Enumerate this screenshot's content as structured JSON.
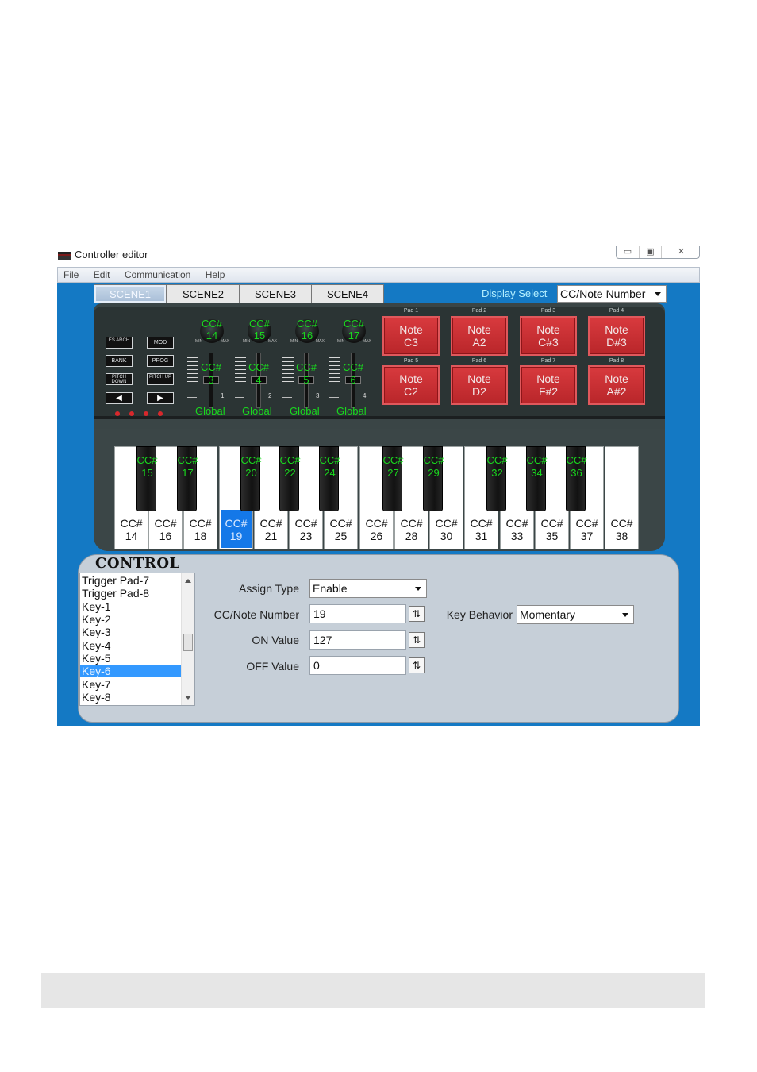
{
  "window": {
    "title": "Controller editor",
    "controls": {
      "minimize": "▭",
      "maximize": "▣",
      "close": "✕"
    }
  },
  "menu": [
    "File",
    "Edit",
    "Communication",
    "Help"
  ],
  "scenes": {
    "tabs": [
      "SCENE1",
      "SCENE2",
      "SCENE3",
      "SCENE4"
    ],
    "active": "SCENE1"
  },
  "display_select": {
    "label": "Display Select",
    "value": "CC/Note Number"
  },
  "panel_buttons": [
    {
      "name": "es-button",
      "label": "ES ARCH"
    },
    {
      "name": "mod-button",
      "label": "MOD"
    },
    {
      "name": "bank-button",
      "label": "BANK"
    },
    {
      "name": "prog-button",
      "label": "PROG"
    },
    {
      "name": "pitch-down-button",
      "label": "PITCH DOWN"
    },
    {
      "name": "pitch-up-button",
      "label": "PITCH UP"
    }
  ],
  "arrows": {
    "left": "◀",
    "right": "▶"
  },
  "knobs": [
    {
      "l1": "CC#",
      "l2": "14",
      "min": "MIN",
      "max": "MAX"
    },
    {
      "l1": "CC#",
      "l2": "15",
      "min": "MIN",
      "max": "MAX"
    },
    {
      "l1": "CC#",
      "l2": "16",
      "min": "MIN",
      "max": "MAX"
    },
    {
      "l1": "CC#",
      "l2": "17",
      "min": "MIN",
      "max": "MAX"
    }
  ],
  "sliders": [
    {
      "l1": "CC#",
      "l2": "3",
      "num": "1",
      "global": "Global"
    },
    {
      "l1": "CC#",
      "l2": "4",
      "num": "2",
      "global": "Global"
    },
    {
      "l1": "CC#",
      "l2": "5",
      "num": "3",
      "global": "Global"
    },
    {
      "l1": "CC#",
      "l2": "6",
      "num": "4",
      "global": "Global"
    }
  ],
  "pads": [
    {
      "label": "Pad 1",
      "l1": "Note",
      "l2": "C3"
    },
    {
      "label": "Pad 2",
      "l1": "Note",
      "l2": "A2"
    },
    {
      "label": "Pad 3",
      "l1": "Note",
      "l2": "C#3"
    },
    {
      "label": "Pad 4",
      "l1": "Note",
      "l2": "D#3"
    },
    {
      "label": "Pad 5",
      "l1": "Note",
      "l2": "C2"
    },
    {
      "label": "Pad 6",
      "l1": "Note",
      "l2": "D2"
    },
    {
      "label": "Pad 7",
      "l1": "Note",
      "l2": "F#2"
    },
    {
      "label": "Pad 8",
      "l1": "Note",
      "l2": "A#2"
    }
  ],
  "white_keys": [
    {
      "c1": "CC#",
      "c2": "14"
    },
    {
      "c1": "CC#",
      "c2": "16"
    },
    {
      "c1": "CC#",
      "c2": "18"
    },
    {
      "c1": "CC#",
      "c2": "19",
      "selected": true
    },
    {
      "c1": "CC#",
      "c2": "21"
    },
    {
      "c1": "CC#",
      "c2": "23"
    },
    {
      "c1": "CC#",
      "c2": "25"
    },
    {
      "c1": "CC#",
      "c2": "26"
    },
    {
      "c1": "CC#",
      "c2": "28"
    },
    {
      "c1": "CC#",
      "c2": "30"
    },
    {
      "c1": "CC#",
      "c2": "31"
    },
    {
      "c1": "CC#",
      "c2": "33"
    },
    {
      "c1": "CC#",
      "c2": "35"
    },
    {
      "c1": "CC#",
      "c2": "37"
    },
    {
      "c1": "CC#",
      "c2": "38"
    }
  ],
  "black_keys": [
    {
      "c1": "CC#",
      "c2": "15"
    },
    {
      "c1": "CC#",
      "c2": "17"
    },
    {
      "c1": "CC#",
      "c2": "20"
    },
    {
      "c1": "CC#",
      "c2": "22"
    },
    {
      "c1": "CC#",
      "c2": "24"
    },
    {
      "c1": "CC#",
      "c2": "27"
    },
    {
      "c1": "CC#",
      "c2": "29"
    },
    {
      "c1": "CC#",
      "c2": "32"
    },
    {
      "c1": "CC#",
      "c2": "34"
    },
    {
      "c1": "CC#",
      "c2": "36"
    }
  ],
  "control": {
    "title": "CONTROL",
    "list": [
      "Trigger Pad-7",
      "Trigger Pad-8",
      "Key-1",
      "Key-2",
      "Key-3",
      "Key-4",
      "Key-5",
      "Key-6",
      "Key-7",
      "Key-8"
    ],
    "selected": "Key-6",
    "assign_type": {
      "label": "Assign Type",
      "value": "Enable"
    },
    "cc_note_number": {
      "label": "CC/Note Number",
      "value": "19"
    },
    "on_value": {
      "label": "ON Value",
      "value": "127"
    },
    "off_value": {
      "label": "OFF Value",
      "value": "0"
    },
    "key_behavior": {
      "label": "Key Behavior",
      "value": "Momentary"
    },
    "spin_glyph": "⇅"
  },
  "colors": {
    "client_bg": "#1479c4",
    "panel_text_green": "#19d81e",
    "pad_red": "#c92f33",
    "selection_blue": "#3399ff"
  }
}
